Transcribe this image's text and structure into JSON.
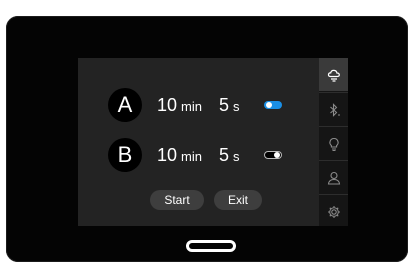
{
  "timers": [
    {
      "id": "A",
      "minutes": "10",
      "minutes_unit": "min",
      "seconds": "5",
      "seconds_unit": "s",
      "enabled": true
    },
    {
      "id": "B",
      "minutes": "10",
      "minutes_unit": "min",
      "seconds": "5",
      "seconds_unit": "s",
      "enabled": false
    }
  ],
  "buttons": {
    "start": "Start",
    "exit": "Exit"
  },
  "sidebar": {
    "items": [
      {
        "icon": "cloud-icon",
        "active": true
      },
      {
        "icon": "bluetooth-icon",
        "active": false
      },
      {
        "icon": "lightbulb-icon",
        "active": false
      },
      {
        "icon": "user-icon",
        "active": false
      },
      {
        "icon": "gear-icon",
        "active": false
      }
    ]
  },
  "colors": {
    "toggle_on": "#1a8fe6",
    "screen_bg": "#232323",
    "sidebar_bg": "#151515",
    "active_item": "#3a3a3a"
  }
}
